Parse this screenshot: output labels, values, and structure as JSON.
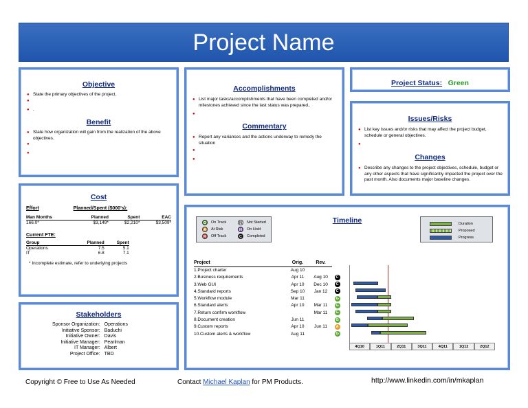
{
  "title": "Project Name",
  "objective": {
    "heading": "Objective",
    "bullets": [
      "State the primary objectives of the project.",
      "",
      "."
    ]
  },
  "benefit": {
    "heading": "Benefit",
    "bullets": [
      "State how organization will gain from the realization of the above objectives.",
      "",
      ""
    ]
  },
  "accomplishments": {
    "heading": "Accomplishments",
    "bullets": [
      "List major tasks/accomplishments that have been completed and/or milestones achieved since the last status was prepared..",
      ""
    ]
  },
  "commentary": {
    "heading": "Commentary",
    "bullets": [
      "Report any variances and the actions underway to remedy the situation",
      "",
      ""
    ]
  },
  "status": {
    "label": "Project Status:",
    "value": "Green"
  },
  "issues": {
    "heading": "Issues/Risks",
    "bullets": [
      "List key issues and/or risks that may affect the project budget, schedule or general objectives.",
      ""
    ]
  },
  "changes": {
    "heading": "Changes",
    "bullets": [
      "Describe any changes to the project objectives, schedule, budget or any other aspects that have significantly impacted the project over the past month. Also documents major baseline changes."
    ]
  },
  "cost": {
    "heading": "Cost",
    "effort_label": "Effort",
    "planned_spent_label": "Planned/Spent ($000's):",
    "cols": [
      "Man Months",
      "Planned",
      "Spent",
      "EAC"
    ],
    "row": [
      "166.0*",
      "$3,149*",
      "$2,210*",
      "$3,509*"
    ],
    "fte_label": "Current FTE:",
    "fte_cols": [
      "Group",
      "Planned",
      "Spent"
    ],
    "fte_rows": [
      [
        "Operations",
        "7.5",
        "5.1"
      ],
      [
        "IT",
        "6.8",
        "7.1"
      ]
    ],
    "note": "* Incomplete estimate, refer to underlying projects"
  },
  "stakeholders": {
    "heading": "Stakeholders",
    "rows": [
      [
        "Sponsor Organization:",
        "Operations"
      ],
      [
        "Initiative Sponsor:",
        "Baduchi"
      ],
      [
        "Initiative Owner:",
        "Davis"
      ],
      [
        "Initiative Manager:",
        "Pearlman"
      ],
      [
        "IT Manager:",
        "Albert"
      ],
      [
        "Project Office:",
        "TBD"
      ]
    ]
  },
  "timeline": {
    "heading": "Timeline",
    "legend_status": [
      {
        "icon": "G",
        "color": "#5aa832",
        "label": "On Track"
      },
      {
        "icon": "A",
        "color": "#e89a2a",
        "label": "At Risk"
      },
      {
        "icon": "R",
        "color": "#d63b2f",
        "label": "Off Track"
      },
      {
        "icon": "N",
        "color": "#ffffff",
        "label": "Not Started"
      },
      {
        "icon": "H",
        "color": "#7a4fb0",
        "label": "On Hold"
      },
      {
        "icon": "C",
        "color": "#000000",
        "label": "Completed"
      }
    ],
    "legend_bars": [
      "Duration",
      "Proposed",
      "Progress"
    ],
    "cols": [
      "Project",
      "Orig.",
      "Rev."
    ],
    "quarters": [
      "4Q10",
      "1Q11",
      "2Q11",
      "3Q11",
      "4Q11",
      "1Q12",
      "2Q12"
    ],
    "tasks": [
      {
        "name": "1.Project charter",
        "orig": "Aug 10",
        "rev": "",
        "status": ""
      },
      {
        "name": "2.Business requirements",
        "orig": "Apr 11",
        "rev": "Aug 10",
        "status": "C"
      },
      {
        "name": "3.Web GUI",
        "orig": "Apr 10",
        "rev": "Dec 10",
        "status": "C"
      },
      {
        "name": "4.Standard reports",
        "orig": "Sep 10",
        "rev": "Jan 12",
        "status": "C"
      },
      {
        "name": "5.Workflow module",
        "orig": "Mar 11",
        "rev": "",
        "status": "G"
      },
      {
        "name": "6.Standard alerts",
        "orig": "Apr 10",
        "rev": "Mar 11",
        "status": "G"
      },
      {
        "name": "7.Return confirm workflow",
        "orig": "",
        "rev": "Mar 11",
        "status": "G"
      },
      {
        "name": "8.Document creation",
        "orig": "Jun 11",
        "rev": "",
        "status": "G"
      },
      {
        "name": "9.Custom reports",
        "orig": "Apr 10",
        "rev": "Jun 11",
        "status": "A"
      },
      {
        "name": "10.Custom alerts & workflow",
        "orig": "Aug 11",
        "rev": "",
        "status": "G"
      }
    ]
  },
  "footer": {
    "copyright": "Copyright © Free to  Use As Needed",
    "contact_pre": "Contact ",
    "contact_link": "Michael Kaplan",
    "contact_post": " for PM Products.",
    "url": "http://www.linkedin.com/in/mkaplan"
  }
}
